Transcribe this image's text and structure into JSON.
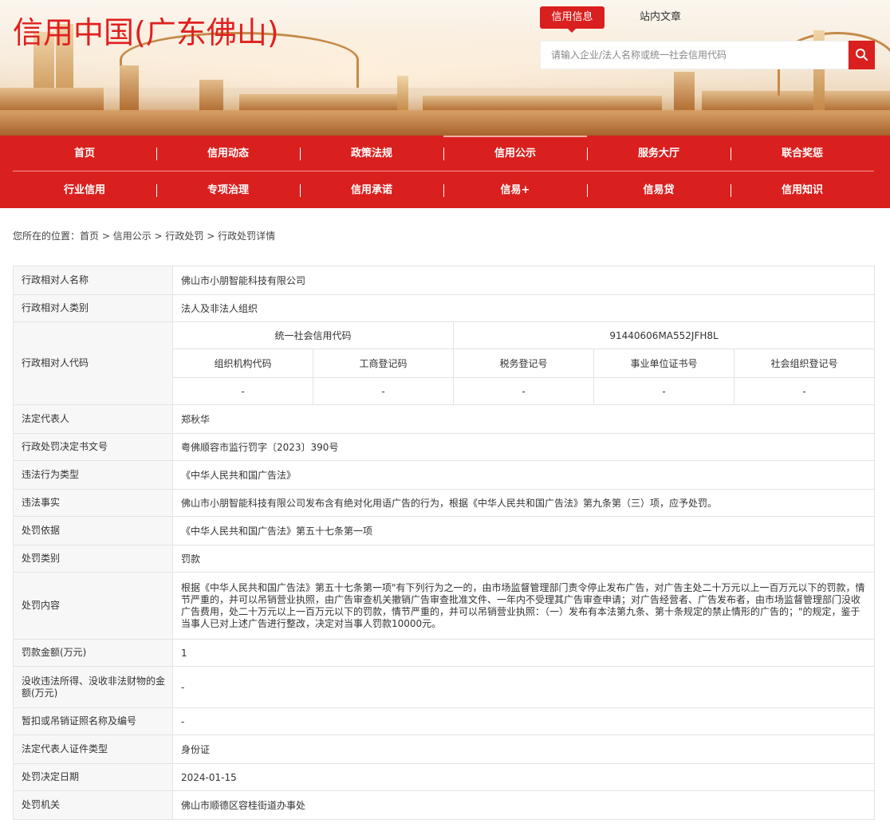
{
  "site": {
    "title": "信用中国(广东佛山)"
  },
  "search": {
    "tabs": [
      "信用信息",
      "站内文章"
    ],
    "placeholder": "请输入企业/法人名称或统一社会信用代码"
  },
  "nav": {
    "row1": [
      "首页",
      "信用动态",
      "政策法规",
      "信用公示",
      "服务大厅",
      "联合奖惩"
    ],
    "row2": [
      "行业信用",
      "专项治理",
      "信用承诺",
      "信易+",
      "信易贷",
      "信用知识"
    ]
  },
  "breadcrumb": {
    "prefix": "您所在的位置：",
    "items": [
      "首页",
      "信用公示",
      "行政处罚",
      "行政处罚详情"
    ],
    "separator": " > "
  },
  "record": {
    "party_name_label": "行政相对人名称",
    "party_name": "佛山市小朋智能科技有限公司",
    "party_type_label": "行政相对人类别",
    "party_type": "法人及非法人组织",
    "party_code_label": "行政相对人代码",
    "uscc_label": "统一社会信用代码",
    "uscc": "91440606MA552JFH8L",
    "code_headers": [
      "组织机构代码",
      "工商登记码",
      "税务登记号",
      "事业单位证书号",
      "社会组织登记号"
    ],
    "code_values": [
      "-",
      "-",
      "-",
      "-",
      "-"
    ],
    "legal_rep_label": "法定代表人",
    "legal_rep": "郑秋华",
    "doc_no_label": "行政处罚决定书文号",
    "doc_no": "粤佛顺容市监行罚字〔2023〕390号",
    "violation_type_label": "违法行为类型",
    "violation_type": "《中华人民共和国广告法》",
    "facts_label": "违法事实",
    "facts": "佛山市小朋智能科技有限公司发布含有绝对化用语广告的行为，根据《中华人民共和国广告法》第九条第（三）项，应予处罚。",
    "basis_label": "处罚依据",
    "basis": "《中华人民共和国广告法》第五十七条第一项",
    "penalty_type_label": "处罚类别",
    "penalty_type": "罚款",
    "content_label": "处罚内容",
    "content": "根据《中华人民共和国广告法》第五十七条第一项\"有下列行为之一的，由市场监督管理部门责令停止发布广告，对广告主处二十万元以上一百万元以下的罚款，情节严重的，并可以吊销营业执照，由广告审查机关撤销广告审查批准文件、一年内不受理其广告审查申请；对广告经营者、广告发布者，由市场监督管理部门没收广告费用，处二十万元以上一百万元以下的罚款，情节严重的，并可以吊销营业执照：（一）发布有本法第九条、第十条规定的禁止情形的广告的；\"的规定，鉴于当事人已对上述广告进行整改，决定对当事人罚款10000元。",
    "fine_label": "罚款金额(万元)",
    "fine": "1",
    "confiscation_label": "没收违法所得、没收非法财物的金额(万元)",
    "confiscation": "-",
    "license_label": "暂扣或吊销证照名称及编号",
    "license": "-",
    "id_type_label": "法定代表人证件类型",
    "id_type": "身份证",
    "date_label": "处罚决定日期",
    "date": "2024-01-15",
    "authority_label": "处罚机关",
    "authority": "佛山市顺德区容桂街道办事处"
  },
  "colors": {
    "brand_red": "#d9201e",
    "label_bg": "#f7f7f7",
    "border": "#e3e3e3"
  }
}
